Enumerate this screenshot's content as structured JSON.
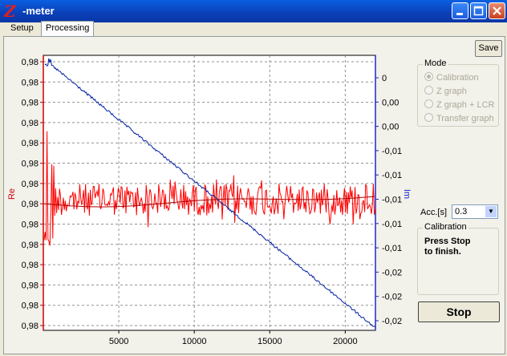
{
  "window": {
    "title": "-meter",
    "logo_letter": "Z"
  },
  "tabs": [
    {
      "label": "Setup",
      "active": false
    },
    {
      "label": "Processing",
      "active": true
    }
  ],
  "buttons": {
    "save": "Save",
    "stop": "Stop"
  },
  "mode": {
    "label": "Mode",
    "options": [
      {
        "label": "Calibration",
        "selected": true
      },
      {
        "label": "Z graph",
        "selected": false
      },
      {
        "label": "Z graph + LCR",
        "selected": false
      },
      {
        "label": "Transfer graph",
        "selected": false
      }
    ]
  },
  "acc": {
    "label": "Acc.[s]",
    "value": "0.3"
  },
  "calibration": {
    "label": "Calibration",
    "message_line1": "Press Stop",
    "message_line2": "to finish."
  },
  "chart_data": {
    "type": "line",
    "x_tick_labels": [
      "5000",
      "10000",
      "15000",
      "20000"
    ],
    "x_ticks": [
      5000,
      10000,
      15000,
      20000
    ],
    "xlim": [
      0,
      22000
    ],
    "ylabel_left": "Re",
    "ylabel_right": "Im",
    "left_tick_labels": [
      "0,98",
      "0,98",
      "0,98",
      "0,98",
      "0,98",
      "0,98",
      "0,98",
      "0,98",
      "0,98",
      "0,98",
      "0,98",
      "0,98",
      "0,98",
      "0,98"
    ],
    "right_tick_labels": [
      "0",
      "0,00",
      "0,00",
      "-0,01",
      "-0,01",
      "-0,01",
      "-0,01",
      "-0,01",
      "-0,02",
      "-0,02",
      "-0,02"
    ],
    "grid": true,
    "colors": {
      "re": "#ff0000",
      "re_mean": "#b00000",
      "im": "#0020a0",
      "left_axis": "#cc0000",
      "right_axis": "#1a28c8"
    },
    "series": [
      {
        "name": "Re",
        "trend": "noisy, approximately constant"
      },
      {
        "name": "Im",
        "trend": "linear decrease",
        "x": [
          0,
          22000
        ],
        "y": [
          0.002,
          -0.0225
        ]
      }
    ]
  }
}
